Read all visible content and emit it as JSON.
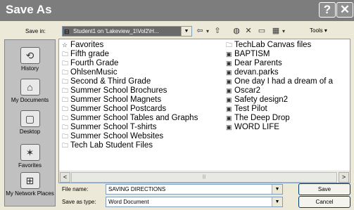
{
  "window": {
    "title": "Save As",
    "help_glyph": "?",
    "close_glyph": "✕"
  },
  "toolbar": {
    "save_in_label": "Save in:",
    "save_in_value": "Student1 on 'Lakeview_1\\Vol2\\H...",
    "back_glyph": "⇦",
    "back_arrow_glyph": "▾",
    "up_folder_glyph": "⇧",
    "search_web_glyph": "◍",
    "delete_glyph": "✕",
    "new_folder_glyph": "▭",
    "views_glyph": "▦",
    "views_arrow_glyph": "▾",
    "tools_label": "Tools ▾"
  },
  "places": [
    {
      "label": "History",
      "glyph": "⟲"
    },
    {
      "label": "My Documents",
      "glyph": "⌂"
    },
    {
      "label": "Desktop",
      "glyph": "▢"
    },
    {
      "label": "Favorites",
      "glyph": "✶"
    },
    {
      "label": "My Network Places",
      "glyph": "⊞"
    }
  ],
  "files": {
    "column1": [
      {
        "name": "Favorites",
        "type": "favorites"
      },
      {
        "name": "Fifth grade",
        "type": "folder"
      },
      {
        "name": "Fourth Grade",
        "type": "folder"
      },
      {
        "name": "OhlsenMusic",
        "type": "folder"
      },
      {
        "name": "Second & Third Grade",
        "type": "folder"
      },
      {
        "name": "Summer School Brochures",
        "type": "folder"
      },
      {
        "name": "Summer School Magnets",
        "type": "folder"
      },
      {
        "name": "Summer School Postcards",
        "type": "folder"
      },
      {
        "name": "Summer School Tables and Graphs",
        "type": "folder"
      },
      {
        "name": "Summer School T-shirts",
        "type": "folder"
      },
      {
        "name": "Summer School Websites",
        "type": "folder"
      },
      {
        "name": "Tech Lab Student Files",
        "type": "folder"
      }
    ],
    "column2": [
      {
        "name": "TechLab Canvas files",
        "type": "folder"
      },
      {
        "name": "BAPTISM",
        "type": "document"
      },
      {
        "name": "Dear Parents",
        "type": "document"
      },
      {
        "name": "devan.parks",
        "type": "document"
      },
      {
        "name": "One day I had a dream of a",
        "type": "document"
      },
      {
        "name": "Oscar2",
        "type": "document"
      },
      {
        "name": "Safety design2",
        "type": "document"
      },
      {
        "name": "Test Pilot",
        "type": "document"
      },
      {
        "name": "The Deep Drop",
        "type": "document"
      },
      {
        "name": "WORD LIFE",
        "type": "document"
      }
    ]
  },
  "scrollbar": {
    "left_glyph": "<",
    "right_glyph": ">",
    "thumb_grip": "|||"
  },
  "footer": {
    "file_name_label": "File name:",
    "file_name_value": "SAVING DIRECTIONS",
    "save_as_type_label": "Save as type:",
    "save_as_type_value": "Word Document",
    "dropdown_glyph": "▼",
    "save_button": "Save",
    "cancel_button": "Cancel"
  },
  "icons": {
    "folder": "🗀",
    "document": "▣",
    "favorites": "☆"
  }
}
